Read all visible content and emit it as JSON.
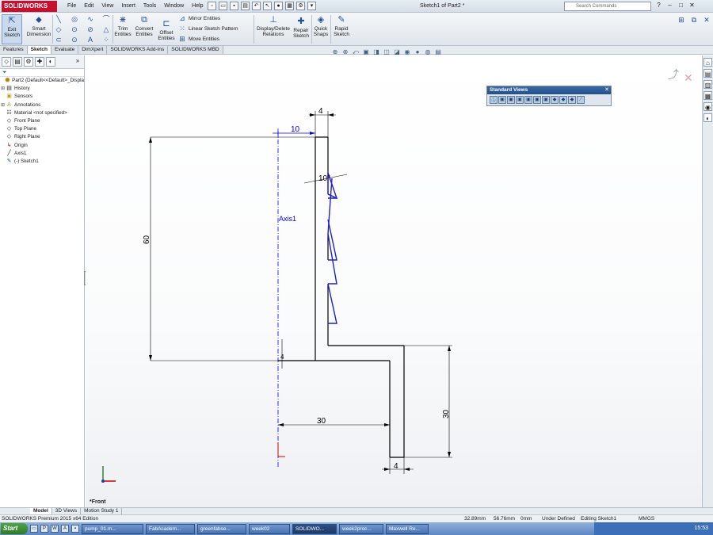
{
  "titlebar": {
    "logo": "SOLIDWORKS",
    "menus": [
      "File",
      "Edit",
      "View",
      "Insert",
      "Tools",
      "Window",
      "Help"
    ],
    "document_title": "Sketch1 of Part2 *",
    "search_placeholder": "Search Commands"
  },
  "commands": {
    "exit_sketch": "Exit Sketch",
    "smart_dimension": "Smart Dimension",
    "trim_entities": "Trim Entities",
    "convert_entities": "Convert Entities",
    "offset_entities": "Offset Entities",
    "mirror_entities": "Mirror Entities",
    "linear_sketch_pattern": "Linear Sketch Pattern",
    "move_entities": "Move Entities",
    "display_delete_relations": "Display/Delete Relations",
    "repair_sketch": "Repair Sketch",
    "quick_snaps": "Quick Snaps",
    "rapid_sketch": "Rapid Sketch"
  },
  "tabs": [
    "Features",
    "Sketch",
    "Evaluate",
    "DimXpert",
    "SOLIDWORKS Add-Ins",
    "SOLIDWORKS MBD"
  ],
  "active_tab": "Sketch",
  "tree": {
    "root": "Part2  (Default<<Default>_Displa",
    "items": [
      "History",
      "Sensors",
      "Annotations",
      "Material <not specified>",
      "Front Plane",
      "Top Plane",
      "Right Plane",
      "Origin",
      "Axis1",
      "(-) Sketch1"
    ]
  },
  "sketch": {
    "axis_label": "Axis1",
    "dimensions": {
      "top_width": "4",
      "offset": "10",
      "angle": "10°",
      "height": "60",
      "bottom_offset": "30",
      "lower_height": "30",
      "bottom_width": "4",
      "small": "4"
    }
  },
  "standard_views": {
    "title": "Standard Views"
  },
  "view_label": "*Front",
  "model_tabs": [
    "Model",
    "3D Views",
    "Motion Study 1"
  ],
  "status": {
    "edition": "SOLIDWORKS Premium 2015 x64 Edition",
    "x": "32.89mm",
    "y": "56.76mm",
    "z": "0mm",
    "state": "Under Defined",
    "mode": "Editing Sketch1",
    "units": "MMGS"
  },
  "taskbar": {
    "start": "Start",
    "tasks": [
      "pump_01.m...",
      "FabAcadem...",
      "greenfabse...",
      "week02",
      "SOLIDWO...",
      "week2proc...",
      "Maxwell Re..."
    ],
    "active_task": "SOLIDWO...",
    "clock": "15:53"
  },
  "colors": {
    "sketch_blue": "#1f1fd0",
    "dimension_blue": "#0000ff",
    "geometry_black": "#000000",
    "brand_red": "#c8102e"
  }
}
